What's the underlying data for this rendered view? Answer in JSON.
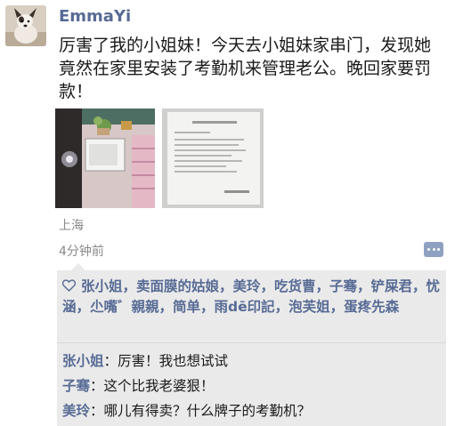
{
  "post": {
    "username": "EmmaYi",
    "text": "厉害了我的小姐妹！今天去小姐妹家串门，发现她竟然在家里安装了考勤机来管理老公。晚回家要罚款！",
    "location": "上海",
    "time": "4分钟前"
  },
  "likes": {
    "names": "张小姐，卖面膜的姑娘，美玲，吃货曹，子骞，铲屎君，忧涵，尐嘴゛親親，简单，雨dē印記，泡芙姐，蛋疼先森"
  },
  "comments": [
    {
      "author": "张小姐",
      "sep": "：",
      "text": "厉害！我也想试试"
    },
    {
      "author": "子骞",
      "sep": "：",
      "text": "这个比我老婆狠！"
    },
    {
      "author": "美玲",
      "sep": "：",
      "text": "哪儿有得卖？什么牌子的考勤机？"
    }
  ],
  "icons": {
    "heart": "heart-icon",
    "comment": "comment-icon"
  },
  "colors": {
    "link": "#576b95",
    "panel": "#eaeaea",
    "meta": "#8a8a8a"
  }
}
